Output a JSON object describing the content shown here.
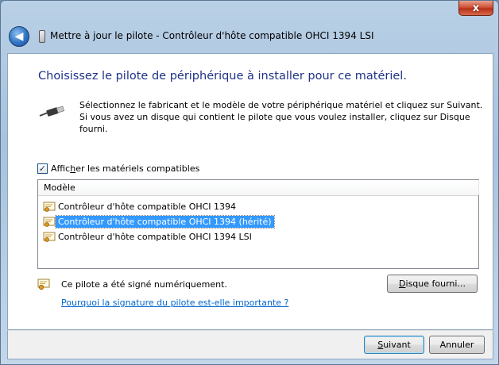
{
  "window": {
    "title": "Mettre à jour le pilote - Contrôleur d'hôte compatible OHCI 1394 LSI",
    "close_label": "x"
  },
  "main": {
    "heading": "Choisissez le pilote de périphérique à installer pour ce matériel.",
    "instructions": "Sélectionnez le fabricant et le modèle de votre périphérique matériel et cliquez sur Suivant. Si vous avez un disque qui contient le pilote que vous voulez installer, cliquez sur Disque fourni.",
    "show_compatible": {
      "checked": true,
      "label_pre": "Affic",
      "label_ul": "h",
      "label_post": "er les matériels compatibles"
    },
    "list": {
      "column_header": "Modèle",
      "items": [
        "Contrôleur d'hôte compatible OHCI 1394",
        "Contrôleur d'hôte compatible OHCI 1394 (hérité)",
        "Contrôleur d'hôte compatible OHCI 1394 LSI"
      ],
      "selected_index": 1
    },
    "signed_text": "Ce pilote a été signé numériquement.",
    "signature_link": "Pourquoi la signature du pilote est-elle importante ?",
    "disk_button": {
      "ul": "D",
      "rest": "isque fourni..."
    }
  },
  "footer": {
    "next_button": {
      "ul": "S",
      "rest": "uivant"
    },
    "cancel_label": "Annuler"
  }
}
